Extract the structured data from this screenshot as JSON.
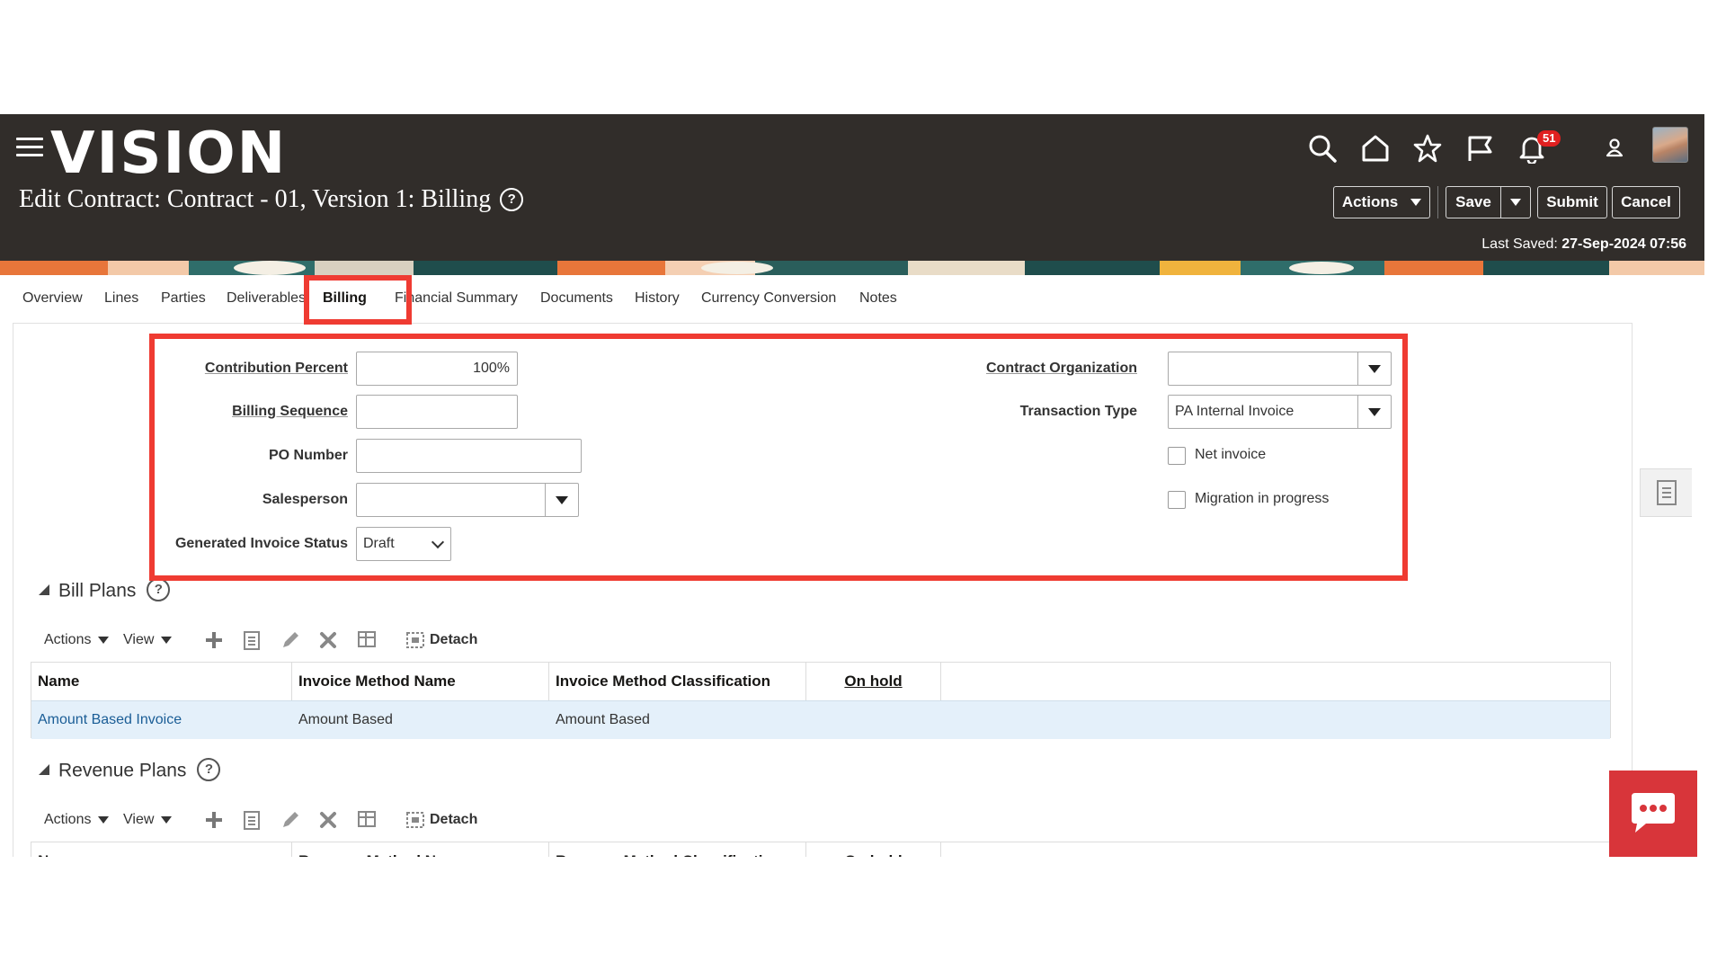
{
  "header": {
    "logo": "VISION",
    "page_title": "Edit Contract: Contract - 01, Version 1: Billing",
    "help": "?",
    "notification_count": "51",
    "buttons": {
      "actions": "Actions",
      "save": "Save",
      "submit": "Submit",
      "cancel": "Cancel"
    },
    "last_saved_label": "Last Saved:",
    "last_saved_value": "27-Sep-2024 07:56",
    "icons": [
      "menu-icon",
      "search-icon",
      "home-icon",
      "star-icon",
      "flag-icon",
      "bell-icon",
      "user-icon",
      "avatar"
    ]
  },
  "tabs": [
    {
      "label": "Overview"
    },
    {
      "label": "Lines"
    },
    {
      "label": "Parties"
    },
    {
      "label": "Deliverables"
    },
    {
      "label": "Billing",
      "active": true
    },
    {
      "label": "Financial Summary"
    },
    {
      "label": "Documents"
    },
    {
      "label": "History"
    },
    {
      "label": "Currency Conversion"
    },
    {
      "label": "Notes"
    }
  ],
  "form": {
    "contribution_percent": {
      "label": "Contribution Percent",
      "value": "100%"
    },
    "billing_sequence": {
      "label": "Billing Sequence",
      "value": ""
    },
    "po_number": {
      "label": "PO Number",
      "value": ""
    },
    "salesperson": {
      "label": "Salesperson",
      "value": ""
    },
    "generated_invoice_status": {
      "label": "Generated Invoice Status",
      "value": "Draft"
    },
    "contract_organization": {
      "label": "Contract Organization",
      "value": ""
    },
    "transaction_type": {
      "label": "Transaction Type",
      "value": "PA Internal Invoice"
    },
    "net_invoice": {
      "label": "Net invoice",
      "checked": false
    },
    "migration_in_progress": {
      "label": "Migration in progress",
      "checked": false
    }
  },
  "bill_plans": {
    "title": "Bill Plans",
    "toolbar": {
      "actions": "Actions",
      "view": "View",
      "detach": "Detach"
    },
    "columns": [
      "Name",
      "Invoice Method Name",
      "Invoice Method Classification",
      "On hold"
    ],
    "rows": [
      {
        "name": "Amount Based Invoice",
        "invoice_method_name": "Amount Based",
        "invoice_method_classification": "Amount Based",
        "on_hold": ""
      }
    ]
  },
  "revenue_plans": {
    "title": "Revenue Plans",
    "toolbar": {
      "actions": "Actions",
      "view": "View",
      "detach": "Detach"
    },
    "columns": [
      "Name",
      "Revenue Method Name",
      "Revenue Method Classification",
      "On hold"
    ]
  },
  "colors": {
    "header_bg": "#312d2a",
    "highlight": "#ef3b32",
    "selected_row": "#e4f0fa",
    "link": "#1a5d96",
    "chat": "#d8353a"
  }
}
